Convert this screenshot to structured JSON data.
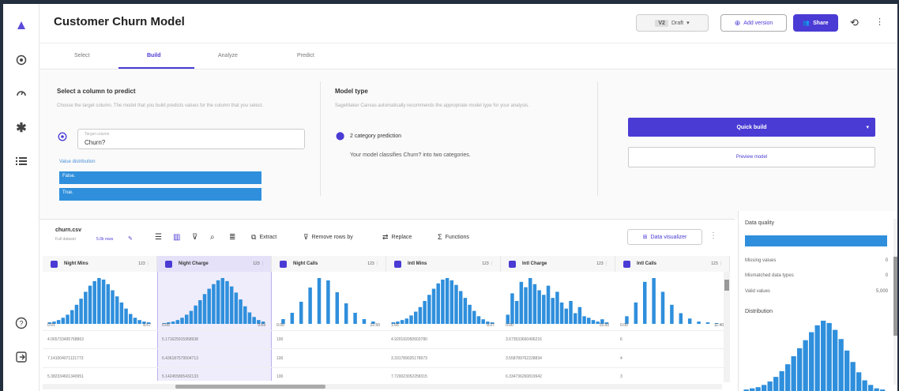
{
  "app": {
    "title": "Customer Churn Model"
  },
  "header": {
    "version_badge": "V2",
    "version_select": "Draft",
    "add_version": "Add version",
    "share": "Share"
  },
  "tabs": [
    "Select",
    "Build",
    "Analyze",
    "Predict"
  ],
  "target": {
    "title": "Select a column to predict",
    "desc": "Choose the target column. The model that you build predicts values for the column that you select.",
    "field_label": "Target column",
    "value": "Churn?",
    "dist_label": "Value distribution",
    "values": [
      "False.",
      "True."
    ]
  },
  "model_type": {
    "title": "Model type",
    "desc": "SageMaker Canvas automatically recommends the appropriate model type for your analysis.",
    "type": "2 category prediction",
    "explain": "Your model classifies Churn? into two categories."
  },
  "build": {
    "quick": "Quick build",
    "preview": "Preview model"
  },
  "dataset": {
    "name": "churn.csv",
    "meta": "Full dataset",
    "rows": "5.0k rows",
    "toolbar": [
      "Extract",
      "Remove rows by",
      "Replace",
      "Functions"
    ],
    "visualizer": "Data visualizer"
  },
  "columns": [
    {
      "name": "Night Mins",
      "type": "123",
      "min": "0.01",
      "max": "8.67",
      "selected": false,
      "bars": [
        2,
        3,
        5,
        8,
        12,
        18,
        25,
        33,
        42,
        50,
        56,
        60,
        58,
        52,
        44,
        36,
        28,
        20,
        13,
        8,
        5,
        3,
        2
      ],
      "cells": [
        "4.065733495768863",
        "7.141004071121773",
        "5.382334601340951"
      ]
    },
    {
      "name": "Night Charge",
      "type": "123",
      "min": "0.05",
      "max": "9.69",
      "selected": true,
      "bars": [
        1,
        2,
        3,
        5,
        8,
        12,
        17,
        24,
        31,
        39,
        46,
        52,
        57,
        60,
        56,
        49,
        41,
        32,
        23,
        15,
        9,
        5,
        3
      ],
      "cells": [
        "5.171625915958938",
        "6.436187579504713",
        "5.142455805432133"
      ]
    },
    {
      "name": "Night Calls",
      "type": "123",
      "min": "0.00",
      "max": "22.50",
      "selected": false,
      "bars": [
        0,
        6,
        0,
        14,
        0,
        28,
        0,
        46,
        0,
        58,
        0,
        55,
        0,
        40,
        0,
        26,
        0,
        14,
        0,
        6,
        0,
        3,
        0
      ],
      "cells": [
        "100",
        "100",
        "100"
      ]
    },
    {
      "name": "Intl Mins",
      "type": "123",
      "min": "1.65",
      "max": "8.07",
      "selected": false,
      "bars": [
        2,
        3,
        5,
        7,
        11,
        16,
        22,
        30,
        38,
        46,
        53,
        58,
        60,
        57,
        51,
        43,
        34,
        25,
        17,
        10,
        6,
        3,
        2
      ],
      "cells": [
        "4.920192050603780",
        "3.331789025178973",
        "7.720023052258315"
      ]
    },
    {
      "name": "Intl Charge",
      "type": "123",
      "min": "0.00",
      "max": "15.50",
      "selected": false,
      "bars": [
        12,
        40,
        30,
        55,
        48,
        60,
        52,
        44,
        38,
        50,
        34,
        42,
        28,
        20,
        30,
        14,
        22,
        10,
        8,
        5,
        3,
        6,
        2
      ],
      "cells": [
        "3.673533660496216",
        "3.558789762228834",
        "6.334736260819942"
      ]
    },
    {
      "name": "Intl Calls",
      "type": "123",
      "min": "0.00",
      "max": "11.40",
      "selected": false,
      "bars": [
        0,
        10,
        0,
        28,
        0,
        55,
        0,
        60,
        0,
        42,
        0,
        25,
        0,
        14,
        0,
        7,
        0,
        3,
        0,
        2,
        0,
        1,
        0
      ],
      "cells": [
        "6",
        "4",
        "3"
      ]
    }
  ],
  "quality": {
    "title": "Data quality",
    "missing_label": "Missing values",
    "missing": "0",
    "mismatch_label": "Mismatched data types",
    "mismatch": "0",
    "valid_label": "Valid values",
    "valid": "5,000",
    "dist_title": "Distribution",
    "dist_bars": [
      2,
      3,
      4,
      6,
      9,
      13,
      18,
      24,
      31,
      38,
      45,
      52,
      58,
      62,
      60,
      54,
      46,
      36,
      26,
      17,
      10,
      6,
      3,
      2
    ]
  }
}
